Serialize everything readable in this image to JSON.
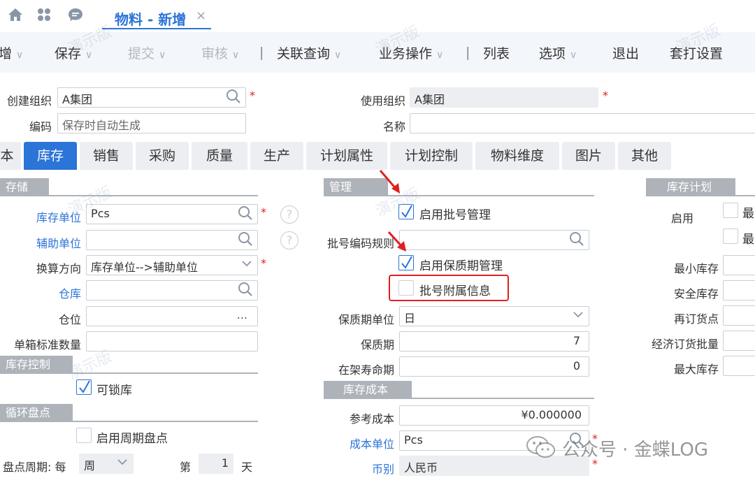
{
  "tabbar": {
    "active_tab": "物料 - 新增",
    "close": "×"
  },
  "toolbar": {
    "items": [
      "增",
      "保存",
      "提交",
      "审核",
      "关联查询",
      "业务操作",
      "列表",
      "选项",
      "退出",
      "套打设置"
    ],
    "separator": "|"
  },
  "header_form": {
    "create_org_label": "创建组织",
    "create_org_value": "A集团",
    "code_label": "编码",
    "code_placeholder": "保存时自动生成",
    "use_org_label": "使用组织",
    "use_org_value": "A集团",
    "name_label": "名称",
    "required": "*"
  },
  "main_tabs": [
    "本",
    "库存",
    "销售",
    "采购",
    "质量",
    "生产",
    "计划属性",
    "计划控制",
    "物料维度",
    "图片",
    "其他"
  ],
  "storage": {
    "title": "存储",
    "stock_unit_label": "库存单位",
    "stock_unit_value": "Pcs",
    "aux_unit_label": "辅助单位",
    "conversion_label": "换算方向",
    "conversion_value": "库存单位-->辅助单位",
    "warehouse_label": "仓库",
    "location_label": "仓位",
    "location_value": "...",
    "box_qty_label": "单箱标准数量",
    "help": "?"
  },
  "stock_control": {
    "title": "库存控制",
    "lockable_label": "可锁库",
    "lockable_checked": true
  },
  "cycle_count": {
    "title": "循环盘点",
    "enable_label": "启用周期盘点",
    "period_label": "盘点周期: 每",
    "period_value": "周",
    "nth_label": "第",
    "nth_value": "1",
    "day_label": "天"
  },
  "management": {
    "title": "管理",
    "batch_mgmt_label": "启用批号管理",
    "batch_mgmt_checked": true,
    "batch_rule_label": "批号编码规则",
    "shelf_mgmt_label": "启用保质期管理",
    "shelf_mgmt_checked": true,
    "batch_extra_label": "批号附属信息",
    "shelf_unit_label": "保质期单位",
    "shelf_unit_value": "日",
    "shelf_label": "保质期",
    "shelf_value": "7",
    "shelf_life_label": "在架寿命期",
    "shelf_life_value": "0"
  },
  "stock_cost": {
    "title": "库存成本",
    "ref_cost_label": "参考成本",
    "ref_cost_value": "¥0.000000",
    "cost_unit_label": "成本单位",
    "cost_unit_value": "Pcs",
    "currency_label": "币别",
    "currency_value": "人民币"
  },
  "stock_plan": {
    "title": "库存计划",
    "enable_label": "启用",
    "min_partial": "最",
    "min_stock_label": "最小库存",
    "safety_stock_label": "安全库存",
    "reorder_label": "再订货点",
    "eoq_label": "经济订货批量",
    "max_stock_label": "最大库存"
  },
  "watermark": "演示版",
  "wechat_watermark": "公众号 · 金蝶LOG",
  "colors": {
    "accent": "#2b74d8",
    "required": "#e02020",
    "section": "#aeb3ba"
  }
}
